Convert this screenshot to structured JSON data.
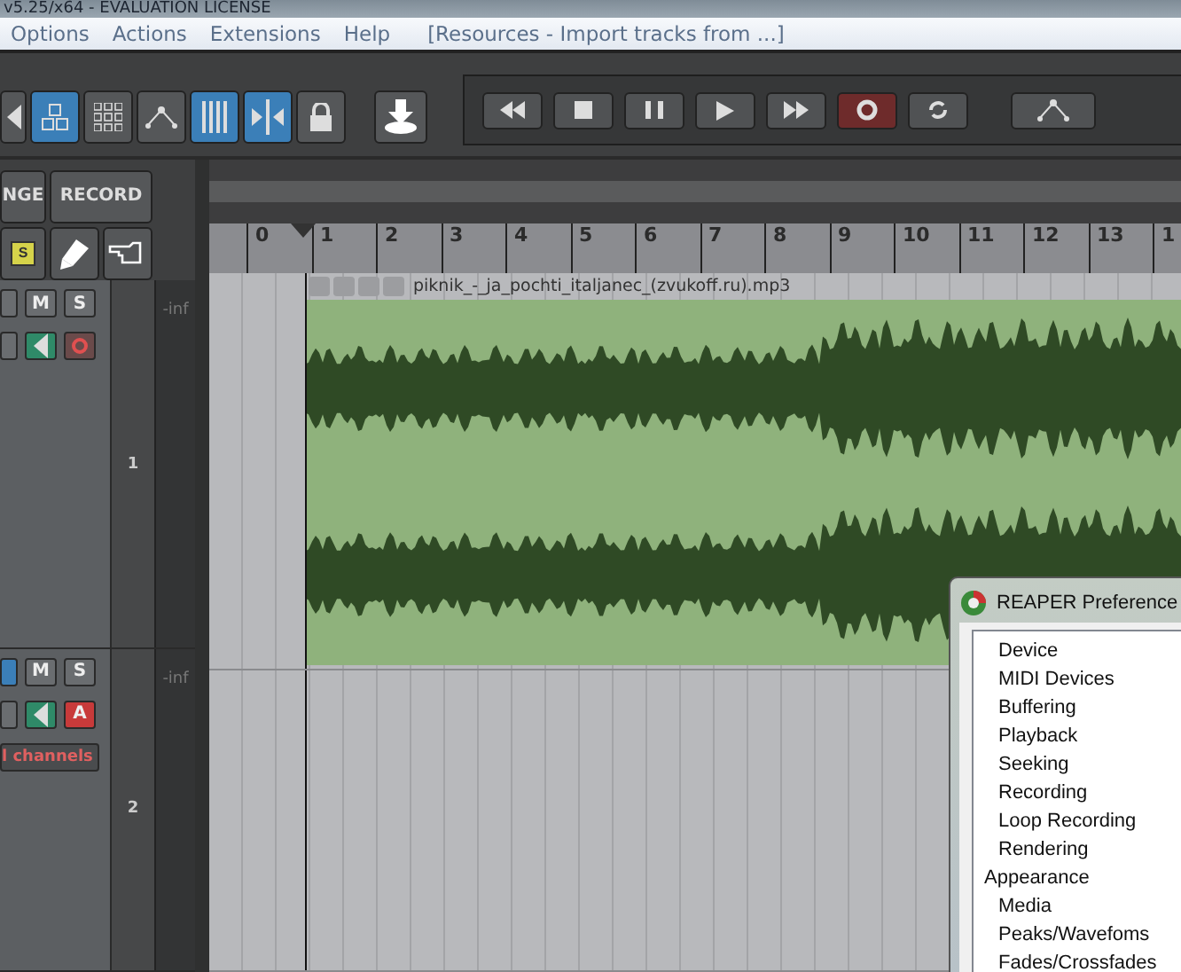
{
  "title": "v5.25/x64 - EVALUATION LICENSE",
  "menu": [
    {
      "label": "Options"
    },
    {
      "label": "Actions"
    },
    {
      "label": "Extensions"
    },
    {
      "label": "Help"
    }
  ],
  "menu_note": "[Resources - Import tracks from ...]",
  "toolbar": [
    {
      "kind": "back",
      "on": false
    },
    {
      "kind": "group",
      "on": true
    },
    {
      "kind": "grid",
      "on": false
    },
    {
      "kind": "envelope",
      "on": false
    },
    {
      "kind": "snap",
      "on": true
    },
    {
      "kind": "ripple",
      "on": true
    },
    {
      "kind": "lock",
      "on": false
    },
    {
      "kind": "download",
      "on": false
    }
  ],
  "transport": [
    {
      "kind": "rewind"
    },
    {
      "kind": "stop"
    },
    {
      "kind": "pause"
    },
    {
      "kind": "play"
    },
    {
      "kind": "forward"
    },
    {
      "kind": "record"
    },
    {
      "kind": "repeat"
    },
    {
      "kind": "envelope"
    }
  ],
  "mode_buttons": [
    {
      "label": "NGE"
    },
    {
      "label": "RECORD"
    }
  ],
  "edit_tools": [
    {
      "kind": "solo",
      "label": "S",
      "on": true
    },
    {
      "kind": "pen"
    },
    {
      "kind": "hand"
    }
  ],
  "ruler": [
    "0",
    "1",
    "2",
    "3",
    "4",
    "5",
    "6",
    "7",
    "8",
    "9",
    "10",
    "11",
    "12",
    "13",
    "1"
  ],
  "tracks": [
    {
      "number": "1",
      "meter": "-inf",
      "mute": "M",
      "solo": "S",
      "routing_on": false,
      "armed": false,
      "item": {
        "name": "piknik_-_ja_pochti_italjanec_(zvukoff.ru).mp3"
      }
    },
    {
      "number": "2",
      "meter": "-inf",
      "mute": "M",
      "solo": "S",
      "routing_on": true,
      "armed": true,
      "arm_label": "A",
      "channels": "l channels"
    }
  ],
  "preferences": {
    "title": "REAPER Preference",
    "items": [
      {
        "children": [
          {
            "label": "Device"
          },
          {
            "label": "MIDI Devices"
          },
          {
            "label": "Buffering"
          },
          {
            "label": "Playback"
          },
          {
            "label": "Seeking"
          },
          {
            "label": "Recording"
          },
          {
            "label": "Loop Recording"
          },
          {
            "label": "Rendering"
          }
        ]
      },
      {
        "label": "Appearance",
        "children": [
          {
            "label": "Media"
          },
          {
            "label": "Peaks/Wavefoms"
          },
          {
            "label": "Fades/Crossfades"
          }
        ]
      }
    ]
  }
}
